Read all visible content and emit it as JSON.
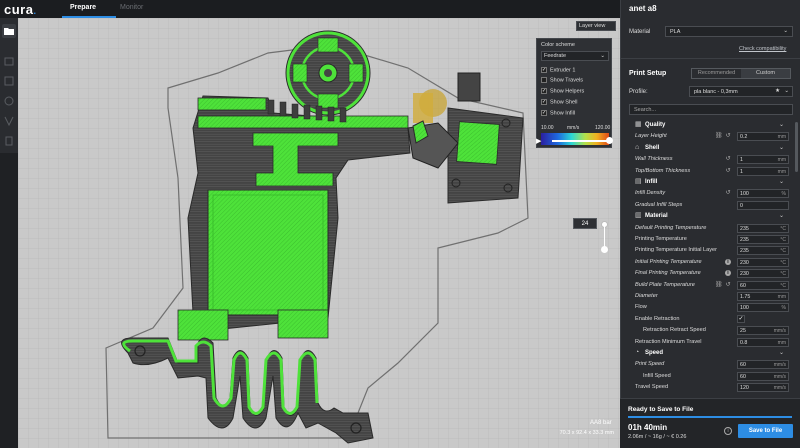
{
  "app": {
    "logo": "cura",
    "logo_dot": "."
  },
  "tabs": [
    {
      "label": "Prepare"
    },
    {
      "label": "Monitor"
    }
  ],
  "viewport": {
    "view_mode": "Layer view",
    "color_scheme_label": "Color scheme",
    "color_scheme": "Feedrate",
    "options": [
      {
        "label": "Extruder 1",
        "checked": true
      },
      {
        "label": "Show Travels",
        "checked": false
      },
      {
        "label": "Show Helpers",
        "checked": true
      },
      {
        "label": "Show Shell",
        "checked": true
      },
      {
        "label": "Show Infill",
        "checked": true
      }
    ],
    "gradient_min": "10.00",
    "gradient_unit": "mm/s",
    "gradient_max": "120.00",
    "current_layer": "24",
    "object_name": "AA8 bar",
    "object_dims": "70.3 x 92.4 x 33.3 mm",
    "colors": {
      "bed": "#c9c9c9",
      "shell": "#3a3a3a",
      "infill": "#4ee23a",
      "travel": "#7a7a7a"
    }
  },
  "sidebar": {
    "printer": "anet a8",
    "material_label": "Material",
    "material": "PLA",
    "compat_link": "Check compatibility",
    "print_setup": "Print Setup",
    "mode_recommended": "Recommended",
    "mode_custom": "Custom",
    "profile_label": "Profile:",
    "profile": "pla blanc - 0,3mm",
    "search_placeholder": "Search...",
    "settings": [
      {
        "type": "cat",
        "label": "Quality",
        "icon": "quality-icon"
      },
      {
        "type": "row",
        "label": "Layer Height",
        "value": "0.2",
        "unit": "mm",
        "italic": true,
        "link": true,
        "reset": true
      },
      {
        "type": "cat",
        "label": "Shell",
        "icon": "shell-icon"
      },
      {
        "type": "row",
        "label": "Wall Thickness",
        "value": "1",
        "unit": "mm",
        "italic": true,
        "reset": true
      },
      {
        "type": "row",
        "label": "Top/Bottom Thickness",
        "value": "1",
        "unit": "mm",
        "italic": true,
        "reset": true
      },
      {
        "type": "cat",
        "label": "Infill",
        "icon": "infill-icon"
      },
      {
        "type": "row",
        "label": "Infill Density",
        "value": "100",
        "unit": "%",
        "italic": true,
        "reset": true
      },
      {
        "type": "row",
        "label": "Gradual Infill Steps",
        "value": "0",
        "unit": "",
        "italic": true
      },
      {
        "type": "cat",
        "label": "Material",
        "icon": "material-icon"
      },
      {
        "type": "row",
        "label": "Default Printing Temperature",
        "value": "235",
        "unit": "°C",
        "italic": true
      },
      {
        "type": "row",
        "label": "Printing Temperature",
        "value": "235",
        "unit": "°C"
      },
      {
        "type": "row",
        "label": "Printing Temperature Initial Layer",
        "value": "235",
        "unit": "°C"
      },
      {
        "type": "row",
        "label": "Initial Printing Temperature",
        "value": "230",
        "unit": "°C",
        "italic": true,
        "info": true
      },
      {
        "type": "row",
        "label": "Final Printing Temperature",
        "value": "230",
        "unit": "°C",
        "italic": true,
        "info": true
      },
      {
        "type": "row",
        "label": "Build Plate Temperature",
        "value": "60",
        "unit": "°C",
        "italic": true,
        "link": true,
        "reset": true
      },
      {
        "type": "row",
        "label": "Diameter",
        "value": "1.75",
        "unit": "mm",
        "italic": true
      },
      {
        "type": "row",
        "label": "Flow",
        "value": "100",
        "unit": "%"
      },
      {
        "type": "check",
        "label": "Enable Retraction",
        "checked": true
      },
      {
        "type": "row",
        "label": "Retraction Retract Speed",
        "value": "25",
        "unit": "mm/s",
        "sub": true
      },
      {
        "type": "row",
        "label": "Retraction Minimum Travel",
        "value": "0.8",
        "unit": "mm"
      },
      {
        "type": "cat",
        "label": "Speed",
        "icon": "speed-icon"
      },
      {
        "type": "row",
        "label": "Print Speed",
        "value": "60",
        "unit": "mm/s",
        "italic": true
      },
      {
        "type": "row",
        "label": "Infill Speed",
        "value": "60",
        "unit": "mm/s",
        "sub": true
      },
      {
        "type": "row",
        "label": "Travel Speed",
        "value": "120",
        "unit": "mm/s"
      }
    ]
  },
  "save": {
    "ready": "Ready to Save to File",
    "progress": 1.0,
    "time": "01h 40min",
    "stats": "2.06m / ~ 16g / ~ € 0.26",
    "button": "Save to File"
  }
}
